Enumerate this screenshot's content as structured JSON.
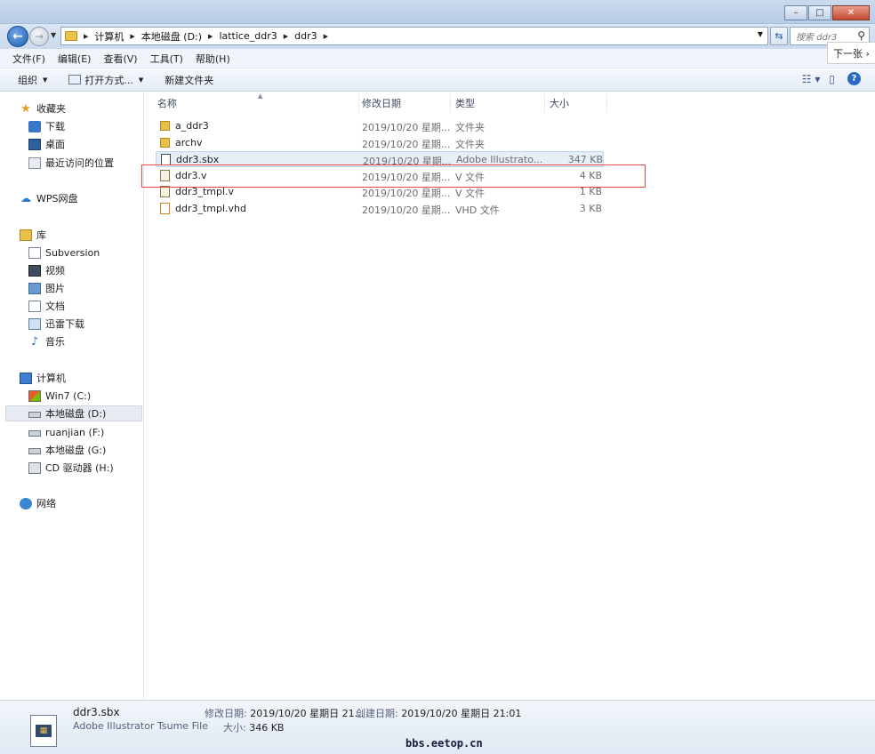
{
  "window": {
    "buttons": {
      "minimize": "–",
      "maximize": "□",
      "close": "✕"
    }
  },
  "address": {
    "crumbs": [
      "计算机",
      "本地磁盘 (D:)",
      "lattice_ddr3",
      "ddr3"
    ],
    "search_placeholder": "搜索 ddr3"
  },
  "overlay": {
    "next_label": "下一张 ›"
  },
  "menu": [
    "文件(F)",
    "编辑(E)",
    "查看(V)",
    "工具(T)",
    "帮助(H)"
  ],
  "toolbar": {
    "organize": "组织",
    "open_with": "打开方式...",
    "new_folder": "新建文件夹"
  },
  "sidebar": {
    "favorites": {
      "label": "收藏夹",
      "items": [
        "下载",
        "桌面",
        "最近访问的位置"
      ]
    },
    "wps": "WPS网盘",
    "libraries": {
      "label": "库",
      "items": [
        "Subversion",
        "视频",
        "图片",
        "文档",
        "迅雷下载",
        "音乐"
      ]
    },
    "computer": {
      "label": "计算机",
      "items": [
        "Win7 (C:)",
        "本地磁盘 (D:)",
        "ruanjian (F:)",
        "本地磁盘 (G:)",
        "CD 驱动器 (H:)"
      ]
    },
    "network": "网络"
  },
  "columns": {
    "name": "名称",
    "date": "修改日期",
    "type": "类型",
    "size": "大小"
  },
  "files": [
    {
      "name": "a_ddr3",
      "date": "2019/10/20 星期...",
      "type": "文件夹",
      "size": ""
    },
    {
      "name": "archv",
      "date": "2019/10/20 星期...",
      "type": "文件夹",
      "size": ""
    },
    {
      "name": "ddr3.sbx",
      "date": "2019/10/20 星期...",
      "type": "Adobe Illustrato...",
      "size": "347 KB"
    },
    {
      "name": "ddr3.v",
      "date": "2019/10/20 星期...",
      "type": "V 文件",
      "size": "4 KB"
    },
    {
      "name": "ddr3_tmpl.v",
      "date": "2019/10/20 星期...",
      "type": "V 文件",
      "size": "1 KB"
    },
    {
      "name": "ddr3_tmpl.vhd",
      "date": "2019/10/20 星期...",
      "type": "VHD 文件",
      "size": "3 KB"
    }
  ],
  "details": {
    "name": "ddr3.sbx",
    "type": "Adobe Illustrator Tsume File",
    "modified_label": "修改日期:",
    "modified": "2019/10/20 星期日 21...",
    "created_label": "创建日期:",
    "created": "2019/10/20 星期日 21:01",
    "size_label": "大小:",
    "size": "346 KB"
  },
  "watermark": "bbs.eetop.cn",
  "colors": {
    "highlight_box": "#e24a45",
    "selected_row": "#e6eef8"
  }
}
